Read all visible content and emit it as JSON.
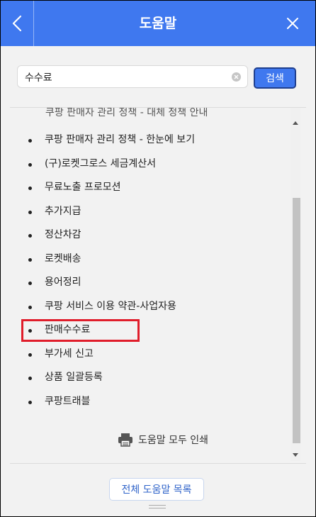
{
  "header": {
    "title": "도움말",
    "accent_color": "#3f78ef",
    "back_icon": "chevron-left-icon",
    "close_icon": "close-icon"
  },
  "search": {
    "query": "수수료",
    "button_label": "검색",
    "clear_icon": "clear-circle-icon"
  },
  "results": {
    "partial_item": "쿠팡 판매자 관리 정책 - 대체 정책 안내",
    "items": [
      {
        "label": "쿠팡 판매자 관리 정책 - 한눈에 보기"
      },
      {
        "label": "(구)로켓그로스 세금계산서"
      },
      {
        "label": "무료노출 프로모션"
      },
      {
        "label": "추가지급"
      },
      {
        "label": "정산차감"
      },
      {
        "label": "로켓배송"
      },
      {
        "label": "용어정리"
      },
      {
        "label": "쿠팡 서비스 이용 약관-사업자용"
      },
      {
        "label": "판매수수료"
      },
      {
        "label": "부가세 신고"
      },
      {
        "label": "상품 일괄등록"
      },
      {
        "label": "쿠팡트래블"
      }
    ],
    "highlighted_item": "판매수수료",
    "highlight_color": "#e01d2b"
  },
  "print": {
    "label": "도움말 모두 인쇄",
    "icon": "printer-icon"
  },
  "footer": {
    "all_topics_label": "전체 도움말 목록"
  }
}
